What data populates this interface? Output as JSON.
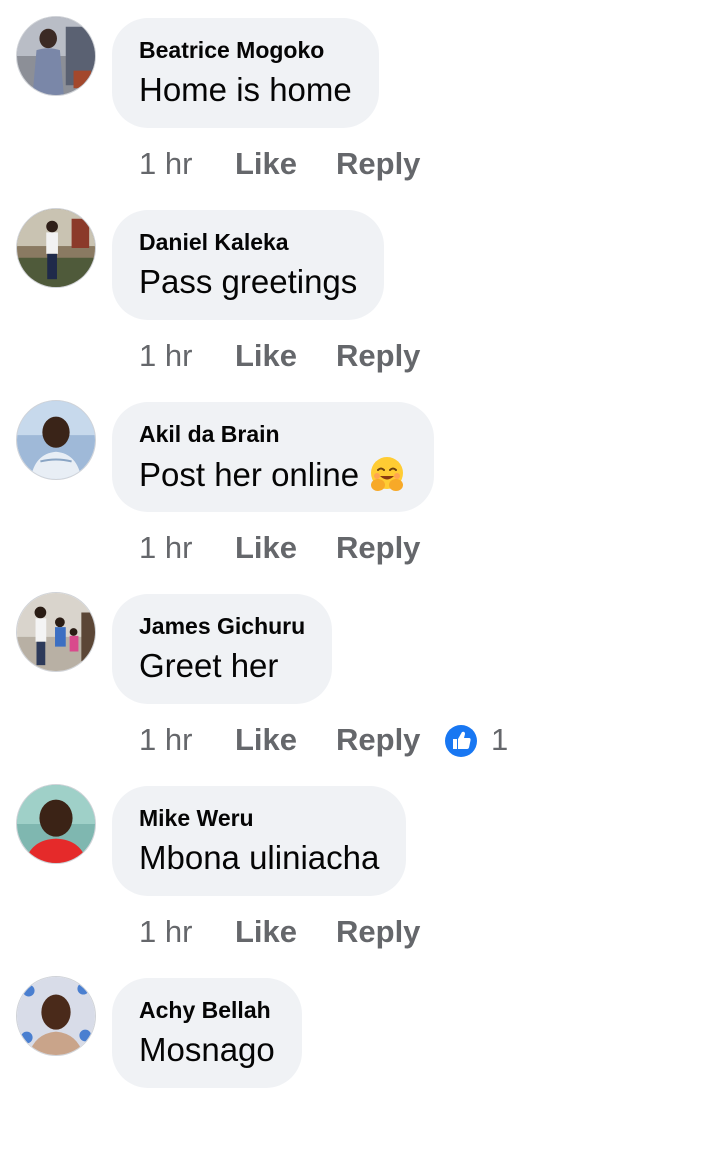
{
  "comments": [
    {
      "author": "Beatrice Mogoko",
      "text": "Home is home",
      "time": "1 hr",
      "like_label": "Like",
      "reply_label": "Reply"
    },
    {
      "author": "Daniel Kaleka",
      "text": "Pass greetings",
      "time": "1 hr",
      "like_label": "Like",
      "reply_label": "Reply"
    },
    {
      "author": "Akil da Brain",
      "text": "Post her online",
      "emoji": "hugging-face-emoji",
      "time": "1 hr",
      "like_label": "Like",
      "reply_label": "Reply"
    },
    {
      "author": "James Gichuru",
      "text": "Greet her",
      "time": "1 hr",
      "like_label": "Like",
      "reply_label": "Reply",
      "reaction_icon": "thumbs-up-icon",
      "reaction_count": "1"
    },
    {
      "author": "Mike Weru",
      "text": "Mbona uliniacha",
      "time": "1 hr",
      "like_label": "Like",
      "reply_label": "Reply"
    },
    {
      "author": "Achy Bellah",
      "text": "Mosnago"
    }
  ],
  "colors": {
    "bubble": "#f0f2f5",
    "meta_text": "#65676b",
    "primary_text": "#050505",
    "like_reaction": "#1877f2"
  }
}
